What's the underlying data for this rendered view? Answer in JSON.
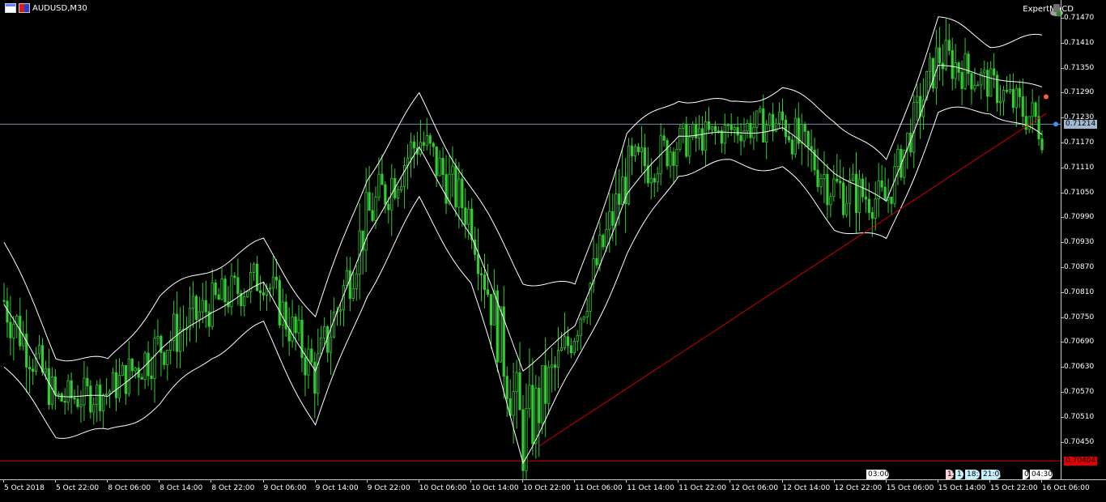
{
  "window": {
    "title": "AUDUSD,M30",
    "expert": "ExpertMACD",
    "symbol_icon": "symbol-table-icon",
    "period_icon": "period-icon",
    "expert_icon": "expert-hat-icon"
  },
  "colors": {
    "background": "#000000",
    "candles": "#32cd32",
    "bands": "#ffffff",
    "trendline": "#d00000",
    "bid_line": "#d00000",
    "price_line": "#7890a8",
    "price_tag": "#a0b8d0",
    "bid_tag": "#e00000"
  },
  "price_axis": [
    "0.71470",
    "0.71410",
    "0.71350",
    "0.71290",
    "0.71230",
    "0.71170",
    "0.71110",
    "0.71050",
    "0.70990",
    "0.70930",
    "0.70870",
    "0.70810",
    "0.70750",
    "0.70690",
    "0.70630",
    "0.70570",
    "0.70510",
    "0.70450"
  ],
  "current_price_label": "0.71214",
  "bid_line_label": "0.70404",
  "time_axis": [
    "5 Oct 2018",
    "5 Oct 22:00",
    "8 Oct 06:00",
    "8 Oct 14:00",
    "8 Oct 22:00",
    "9 Oct 06:00",
    "9 Oct 14:00",
    "9 Oct 22:00",
    "10 Oct 06:00",
    "10 Oct 14:00",
    "10 Oct 22:00",
    "11 Oct 06:00",
    "11 Oct 14:00",
    "11 Oct 22:00",
    "12 Oct 06:00",
    "12 Oct 14:00",
    "12 Oct 22:00",
    "15 Oct 06:00",
    "15 Oct 14:00",
    "15 Oct 22:00",
    "16 Oct 06:00"
  ],
  "session_tags": [
    "03:00",
    "15",
    "17",
    "18:3",
    "21:00",
    "0",
    "04:30"
  ],
  "chart_data": {
    "type": "candlestick",
    "symbol": "AUDUSD",
    "timeframe": "M30",
    "indicator": "Bollinger Bands",
    "ylim": [
      0.704,
      0.715
    ],
    "x": [
      "5 Oct 2018",
      "5 Oct 22:00",
      "8 Oct 06:00",
      "8 Oct 14:00",
      "8 Oct 22:00",
      "9 Oct 06:00",
      "9 Oct 14:00",
      "9 Oct 22:00",
      "10 Oct 06:00",
      "10 Oct 14:00",
      "10 Oct 22:00",
      "11 Oct 06:00",
      "11 Oct 14:00",
      "11 Oct 22:00",
      "12 Oct 06:00",
      "12 Oct 14:00",
      "12 Oct 22:00",
      "15 Oct 06:00",
      "15 Oct 14:00",
      "15 Oct 22:00",
      "16 Oct 06:00"
    ],
    "series": [
      {
        "name": "close",
        "values": [
          0.7079,
          0.7055,
          0.7057,
          0.7068,
          0.7078,
          0.7085,
          0.7061,
          0.7099,
          0.7118,
          0.7099,
          0.7046,
          0.7072,
          0.7109,
          0.7117,
          0.712,
          0.7122,
          0.7106,
          0.7103,
          0.7138,
          0.7131,
          0.7121
        ]
      },
      {
        "name": "upper band",
        "values": [
          0.7093,
          0.7066,
          0.7064,
          0.708,
          0.7087,
          0.7093,
          0.7075,
          0.7109,
          0.7128,
          0.7106,
          0.7084,
          0.7082,
          0.7119,
          0.7128,
          0.7126,
          0.713,
          0.7123,
          0.7112,
          0.7147,
          0.7141,
          0.7142
        ]
      },
      {
        "name": "lower band",
        "values": [
          0.7063,
          0.7047,
          0.7047,
          0.7054,
          0.7066,
          0.7073,
          0.7049,
          0.7081,
          0.7103,
          0.7083,
          0.7041,
          0.7063,
          0.709,
          0.711,
          0.7112,
          0.7111,
          0.7097,
          0.7093,
          0.7124,
          0.7125,
          0.7118
        ]
      }
    ],
    "trendline": [
      {
        "x": "10 Oct 22:00",
        "y": 0.7044
      },
      {
        "x": "16 Oct 06:00",
        "y": 0.7124
      }
    ],
    "bid_line": 0.70404,
    "current_price": 0.71214
  }
}
